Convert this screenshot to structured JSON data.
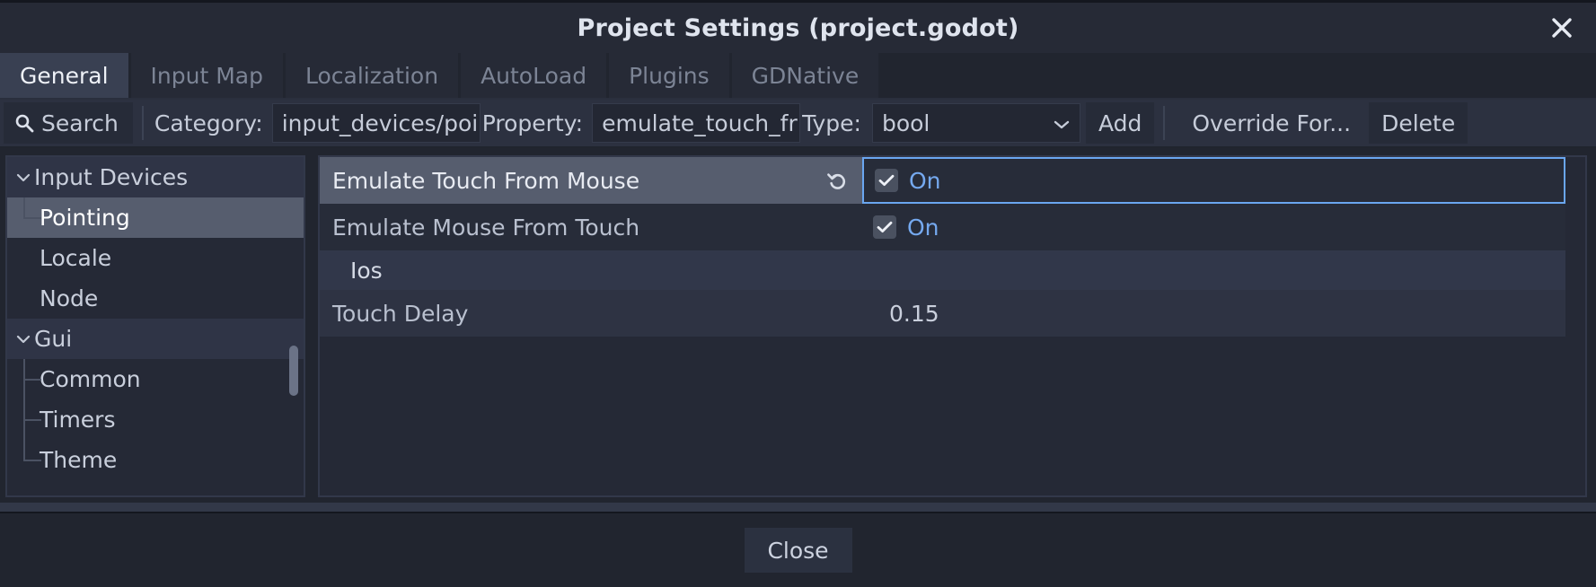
{
  "window": {
    "title": "Project Settings (project.godot)",
    "close_icon": "close-icon"
  },
  "tabs": [
    {
      "label": "General",
      "active": true
    },
    {
      "label": "Input Map",
      "active": false
    },
    {
      "label": "Localization",
      "active": false
    },
    {
      "label": "AutoLoad",
      "active": false
    },
    {
      "label": "Plugins",
      "active": false
    },
    {
      "label": "GDNative",
      "active": false
    }
  ],
  "toolbar": {
    "search_label": "Search",
    "search_icon": "search-icon",
    "category_label": "Category:",
    "category_value": "input_devices/poi",
    "property_label": "Property:",
    "property_value": "emulate_touch_fr",
    "type_label": "Type:",
    "type_value": "bool",
    "type_chevron_icon": "chevron-down-icon",
    "add_label": "Add",
    "override_label": "Override For...",
    "delete_label": "Delete"
  },
  "tree": {
    "items": [
      {
        "label": "Input Devices",
        "kind": "category",
        "expanded": true,
        "selected": false,
        "indent": 0
      },
      {
        "label": "Pointing",
        "kind": "leaf",
        "expanded": false,
        "selected": true,
        "indent": 1
      },
      {
        "label": "Locale",
        "kind": "leaf",
        "expanded": false,
        "selected": false,
        "indent": 1
      },
      {
        "label": "Node",
        "kind": "leaf",
        "expanded": false,
        "selected": false,
        "indent": 1
      },
      {
        "label": "Gui",
        "kind": "category",
        "expanded": true,
        "selected": false,
        "indent": 0
      },
      {
        "label": "Common",
        "kind": "leaf",
        "expanded": false,
        "selected": false,
        "indent": 1
      },
      {
        "label": "Timers",
        "kind": "leaf",
        "expanded": false,
        "selected": false,
        "indent": 1
      },
      {
        "label": "Theme",
        "kind": "leaf",
        "expanded": false,
        "selected": false,
        "indent": 1
      }
    ]
  },
  "properties": {
    "rows": [
      {
        "name": "Emulate Touch From Mouse",
        "type": "bool",
        "value": "On",
        "checked": true,
        "focused": true,
        "highlighted": true,
        "has_revert": true,
        "revert_icon": "revert-icon"
      },
      {
        "name": "Emulate Mouse From Touch",
        "type": "bool",
        "value": "On",
        "checked": true,
        "focused": false,
        "highlighted": false,
        "has_revert": false
      },
      {
        "name": "Ios",
        "type": "section"
      },
      {
        "name": "Touch Delay",
        "type": "number",
        "value": "0.15",
        "focused": false,
        "highlighted": false,
        "has_revert": false
      }
    ]
  },
  "footer": {
    "close_label": "Close"
  },
  "colors": {
    "window_bg": "#21252f",
    "titlebar_bg": "#262a36",
    "toolbar_bg": "#2c3140",
    "panel_bg": "#252936",
    "accent_blue": "#6aa6f0",
    "bool_text": "#75a9ef",
    "selected_row": "#565d6e",
    "tab_active": "#394052"
  }
}
